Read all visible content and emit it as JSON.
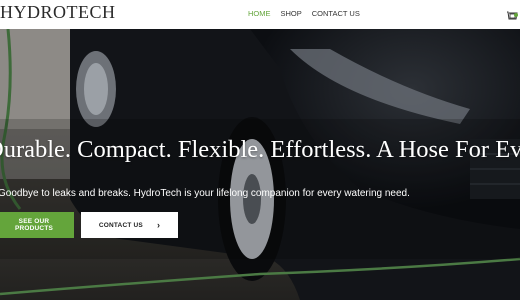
{
  "header": {
    "logo": "HYDROTECH",
    "nav": [
      {
        "label": "HOME",
        "active": true
      },
      {
        "label": "SHOP",
        "active": false
      },
      {
        "label": "CONTACT US",
        "active": false
      }
    ],
    "cart_icon": "cart-icon"
  },
  "hero": {
    "headline": "Durable. Compact. Flexible. Effortless. A Hose For Everything.",
    "subtext": "Goodbye to leaks and breaks. HydroTech is your lifelong companion for every watering need.",
    "primary_button": "SEE OUR PRODUCTS",
    "secondary_button": "CONTACT US",
    "secondary_icon": "chevron-right-icon"
  },
  "colors": {
    "accent": "#64a53b",
    "text_dark": "#333333",
    "white": "#ffffff"
  }
}
